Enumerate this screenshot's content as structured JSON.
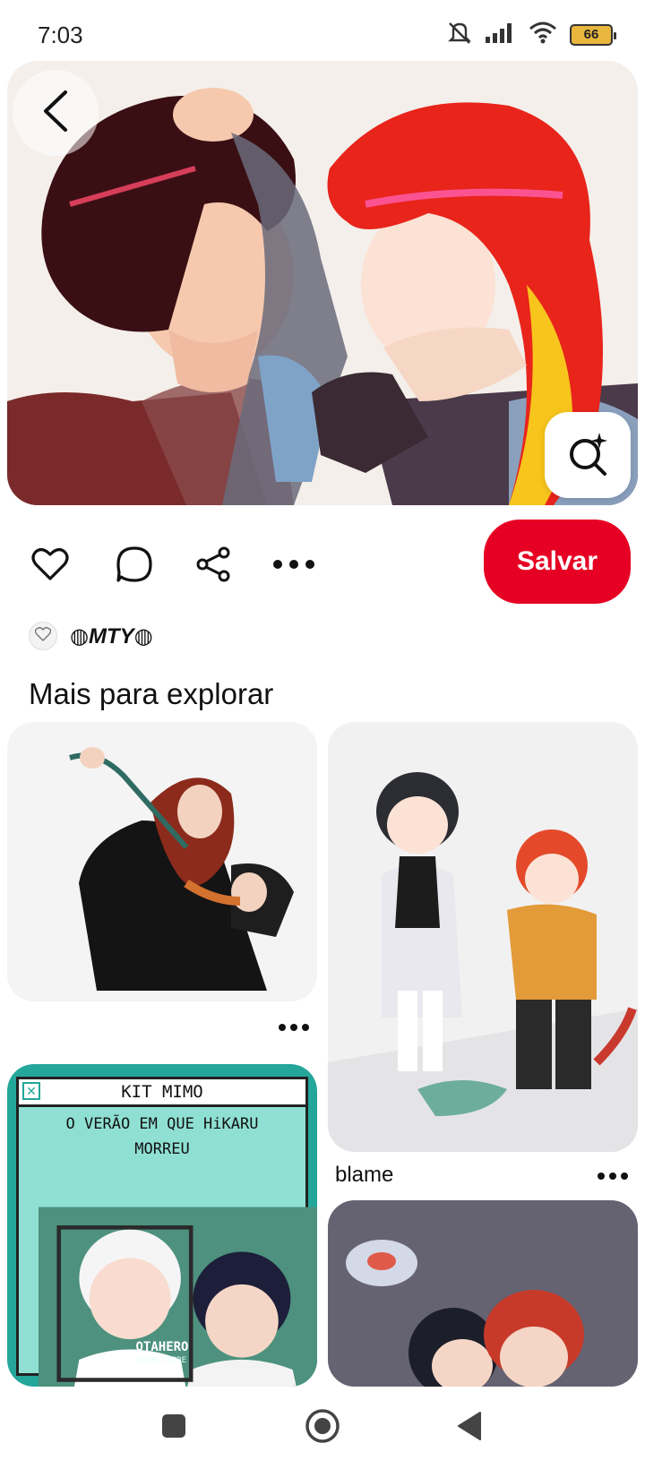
{
  "status_bar": {
    "time": "7:03",
    "battery_level": "66",
    "icons": [
      "mute-icon",
      "signal-icon",
      "wifi-icon",
      "battery-icon"
    ]
  },
  "pin": {
    "back_icon": "chevron-left-icon",
    "visual_search_icon": "visual-search-sparkle-icon"
  },
  "actions": {
    "icons": [
      "heart-icon",
      "comment-icon",
      "share-icon",
      "more-icon"
    ],
    "save_label": "Salvar",
    "save_color": "#e60023"
  },
  "creator": {
    "name": "◍MTY◍"
  },
  "explore": {
    "title": "Mais para explorar",
    "cards": [
      {
        "caption": "",
        "has_more_menu": true
      },
      {
        "caption": "blame",
        "has_more_menu": true
      },
      {
        "caption": "",
        "text_lines": [
          "KIT MIMO",
          "O VERÃO EM QUE HiKARU",
          "MORREU",
          "OTAHERO",
          "GEEK STORE"
        ]
      },
      {
        "caption": ""
      }
    ]
  },
  "nav_bar": {
    "icons": [
      "recent-apps-icon",
      "home-icon",
      "back-triangle-icon"
    ]
  }
}
